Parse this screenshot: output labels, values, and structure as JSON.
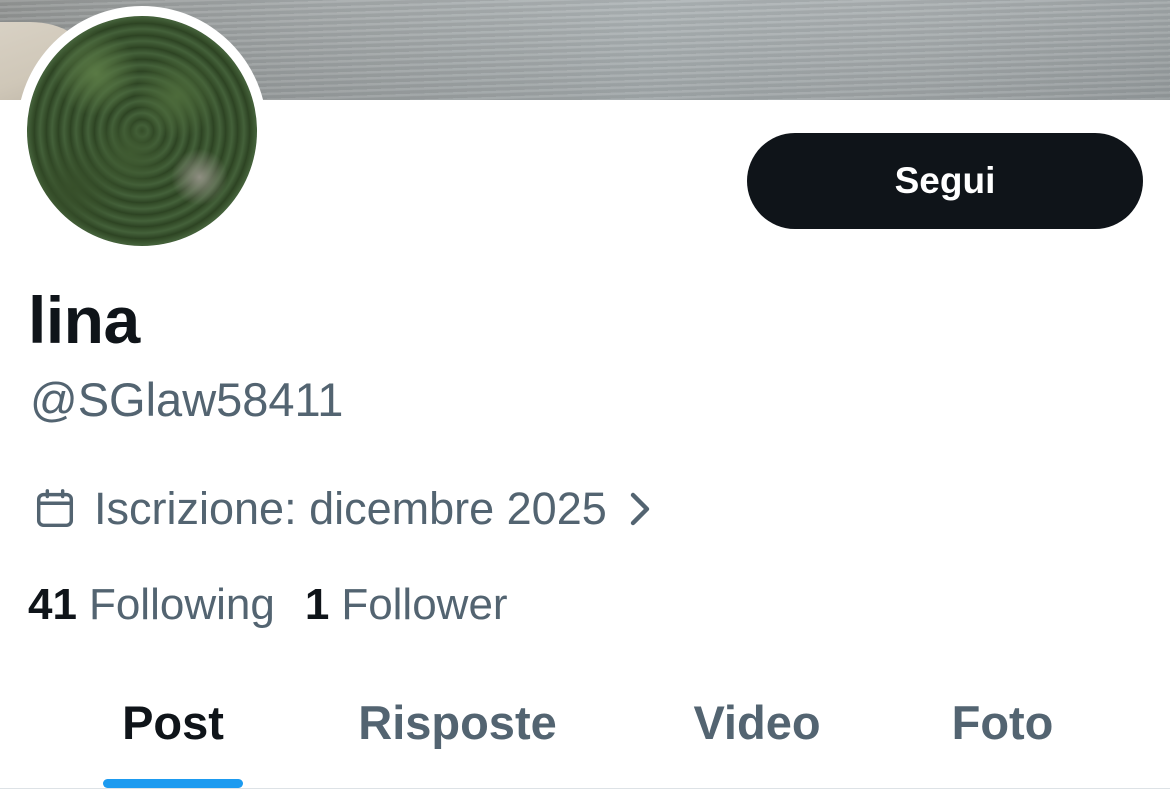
{
  "profile": {
    "display_name": "lina",
    "handle": "@SGlaw58411",
    "joined_text": "Iscrizione: dicembre 2025",
    "follow_label": "Segui",
    "banner_icon": "banner-image",
    "avatar_icon": "avatar-image"
  },
  "stats": {
    "following": {
      "count": "41",
      "label": "Following"
    },
    "followers": {
      "count": "1",
      "label": "Follower"
    }
  },
  "tabs": [
    {
      "label": "Post",
      "active": true
    },
    {
      "label": "Risposte",
      "active": false
    },
    {
      "label": "Video",
      "active": false
    },
    {
      "label": "Foto",
      "active": false
    }
  ],
  "icons": {
    "calendar": "calendar-icon",
    "chevron": "chevron-right-icon"
  },
  "colors": {
    "text_primary": "#0f1419",
    "text_secondary": "#536471",
    "accent": "#1d9bf0",
    "button_bg": "#0f1419"
  }
}
